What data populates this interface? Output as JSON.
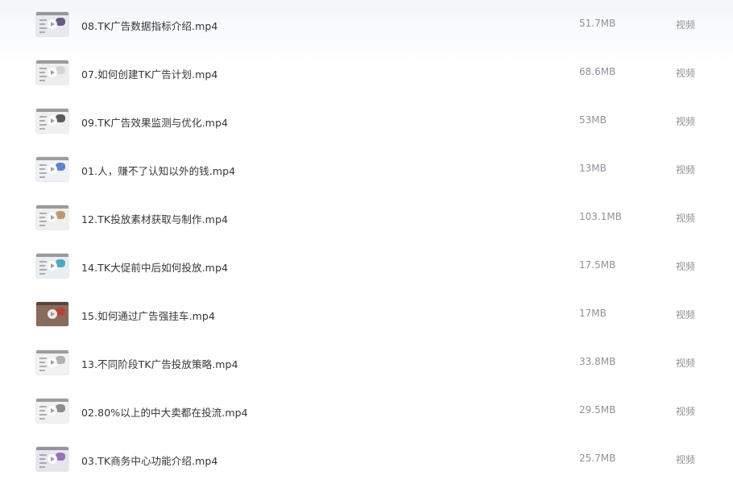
{
  "files": [
    {
      "name": "08.TK广告数据指标介绍.mp4",
      "size": "51.7MB",
      "type": "视频",
      "thumb_icon": "video-thumbnail-icon",
      "thumb_bg": "#e8e9ef",
      "thumb_accent": "#3b2a5c"
    },
    {
      "name": "07.如何创建TK广告计划.mp4",
      "size": "68.6MB",
      "type": "视频",
      "thumb_icon": "video-thumbnail-icon",
      "thumb_bg": "#eeeeee",
      "thumb_accent": "#c9c9c9"
    },
    {
      "name": "09.TK广告效果监测与优化.mp4",
      "size": "53MB",
      "type": "视频",
      "thumb_icon": "video-thumbnail-icon",
      "thumb_bg": "#f0f0f0",
      "thumb_accent": "#2b2b2b"
    },
    {
      "name": "01.人，赚不了认知以外的钱.mp4",
      "size": "13MB",
      "type": "视频",
      "thumb_icon": "video-thumbnail-icon",
      "thumb_bg": "#eef1f6",
      "thumb_accent": "#2f5fb8"
    },
    {
      "name": "12.TK投放素材获取与制作.mp4",
      "size": "103.1MB",
      "type": "视频",
      "thumb_icon": "video-thumbnail-icon",
      "thumb_bg": "#efefef",
      "thumb_accent": "#b07a4a"
    },
    {
      "name": "14.TK大促前中后如何投放.mp4",
      "size": "17.5MB",
      "type": "视频",
      "thumb_icon": "video-thumbnail-icon",
      "thumb_bg": "#e9eef2",
      "thumb_accent": "#1f8fb0"
    },
    {
      "name": "15.如何通过广告强挂车.mp4",
      "size": "17MB",
      "type": "视频",
      "thumb_icon": "video-thumbnail-icon",
      "thumb_bg": "#8a6a5a",
      "thumb_accent": "#c0392b"
    },
    {
      "name": "13.不同阶段TK广告投放策略.mp4",
      "size": "33.8MB",
      "type": "视频",
      "thumb_icon": "video-thumbnail-icon",
      "thumb_bg": "#f2f2f2",
      "thumb_accent": "#9b9b9b"
    },
    {
      "name": "02.80%以上的中大卖都在投流.mp4",
      "size": "29.5MB",
      "type": "视频",
      "thumb_icon": "video-thumbnail-icon",
      "thumb_bg": "#f1f1f1",
      "thumb_accent": "#6b6b6b"
    },
    {
      "name": "03.TK商务中心功能介绍.mp4",
      "size": "25.7MB",
      "type": "视频",
      "thumb_icon": "video-thumbnail-icon",
      "thumb_bg": "#e6e4ee",
      "thumb_accent": "#7a4fa0"
    }
  ]
}
